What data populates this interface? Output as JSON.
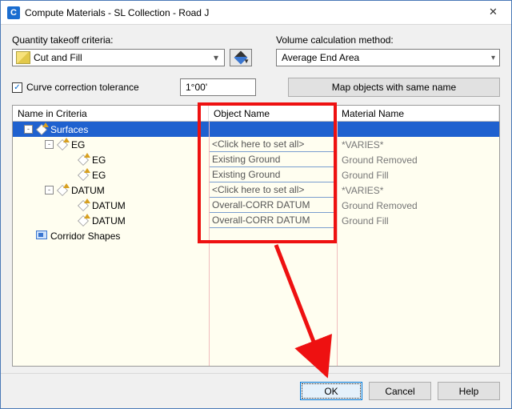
{
  "window": {
    "title": "Compute Materials - SL Collection - Road J"
  },
  "criteria": {
    "label": "Quantity takeoff criteria:",
    "value": "Cut and Fill"
  },
  "volume": {
    "label": "Volume calculation method:",
    "value": "Average End Area"
  },
  "curve": {
    "label": "Curve correction tolerance",
    "value": "1°00'"
  },
  "mapbtn": "Map objects with same name",
  "grid": {
    "headers": {
      "c1": "Name in Criteria",
      "c2": "Object Name",
      "c3": "Material Name"
    },
    "rows": [
      {
        "indent": 0,
        "expander": "-",
        "icon": "surface",
        "name": "Surfaces",
        "object": "",
        "material": "",
        "selected": true
      },
      {
        "indent": 1,
        "expander": "-",
        "icon": "surface",
        "name": "EG",
        "object": "<Click here to set all>",
        "material": "*VARIES*"
      },
      {
        "indent": 2,
        "expander": "",
        "icon": "surface",
        "name": "EG",
        "object": "Existing Ground",
        "material": "Ground Removed"
      },
      {
        "indent": 2,
        "expander": "",
        "icon": "surface",
        "name": "EG",
        "object": "Existing Ground",
        "material": "Ground Fill"
      },
      {
        "indent": 1,
        "expander": "-",
        "icon": "surface",
        "name": "DATUM",
        "object": "<Click here to set all>",
        "material": "*VARIES*"
      },
      {
        "indent": 2,
        "expander": "",
        "icon": "surface",
        "name": "DATUM",
        "object": "Overall-CORR DATUM",
        "material": "Ground Removed"
      },
      {
        "indent": 2,
        "expander": "",
        "icon": "surface",
        "name": "DATUM",
        "object": "Overall-CORR DATUM",
        "material": "Ground Fill"
      },
      {
        "indent": 0,
        "expander": "",
        "icon": "shapes",
        "name": "Corridor Shapes",
        "object": "",
        "material": ""
      }
    ]
  },
  "buttons": {
    "ok": "OK",
    "cancel": "Cancel",
    "help": "Help"
  }
}
